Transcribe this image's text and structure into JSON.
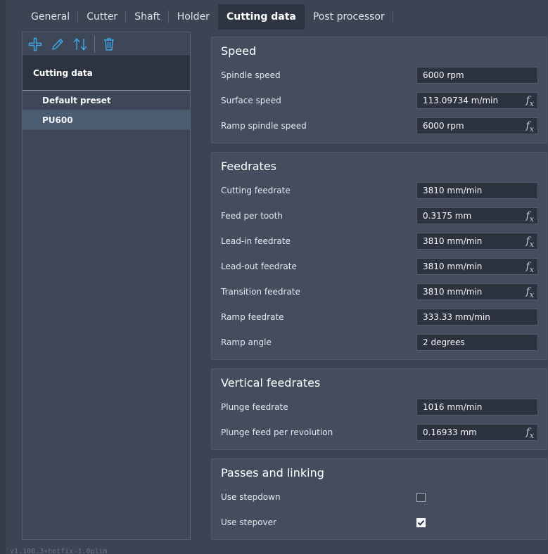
{
  "tabs": [
    {
      "label": "General"
    },
    {
      "label": "Cutter"
    },
    {
      "label": "Shaft"
    },
    {
      "label": "Holder"
    },
    {
      "label": "Cutting data"
    },
    {
      "label": "Post processor"
    }
  ],
  "active_tab": "Cutting data",
  "toolbar": {
    "icons": [
      "add-icon",
      "edit-pencil-icon",
      "sort-icon",
      "delete-trash-icon"
    ],
    "accent_color": "#3ea8e8"
  },
  "presets": {
    "header": "Cutting data",
    "items": [
      {
        "label": "Default preset"
      },
      {
        "label": "PU600"
      }
    ],
    "selected": "PU600"
  },
  "groups": {
    "speed": {
      "title": "Speed",
      "rows": [
        {
          "label": "Spindle speed",
          "value": "6000 rpm",
          "fx": ""
        },
        {
          "label": "Surface speed",
          "value": "113.09734 m/min",
          "fx": "f"
        },
        {
          "label": "Ramp spindle speed",
          "value": "6000 rpm",
          "fx": "f"
        }
      ]
    },
    "feedrates": {
      "title": "Feedrates",
      "rows": [
        {
          "label": "Cutting feedrate",
          "value": "3810 mm/min",
          "fx": ""
        },
        {
          "label": "Feed per tooth",
          "value": "0.3175 mm",
          "fx": "f"
        },
        {
          "label": "Lead-in feedrate",
          "value": "3810 mm/min",
          "fx": "f"
        },
        {
          "label": "Lead-out feedrate",
          "value": "3810 mm/min",
          "fx": "f"
        },
        {
          "label": "Transition feedrate",
          "value": "3810 mm/min",
          "fx": "f"
        },
        {
          "label": "Ramp feedrate",
          "value": "333.33 mm/min",
          "fx": ""
        },
        {
          "label": "Ramp angle",
          "value": "2 degrees",
          "fx": ""
        }
      ]
    },
    "vertical": {
      "title": "Vertical feedrates",
      "rows": [
        {
          "label": "Plunge feedrate",
          "value": "1016 mm/min",
          "fx": ""
        },
        {
          "label": "Plunge feed per revolution",
          "value": "0.16933 mm",
          "fx": "f"
        }
      ]
    },
    "passes": {
      "title": "Passes and linking",
      "rows": [
        {
          "label": "Use stepdown",
          "checked": false
        },
        {
          "label": "Use stepover",
          "checked": true
        }
      ]
    }
  },
  "fx_sub": "x",
  "version": "v1.108.3+hotfix-1.0plim"
}
